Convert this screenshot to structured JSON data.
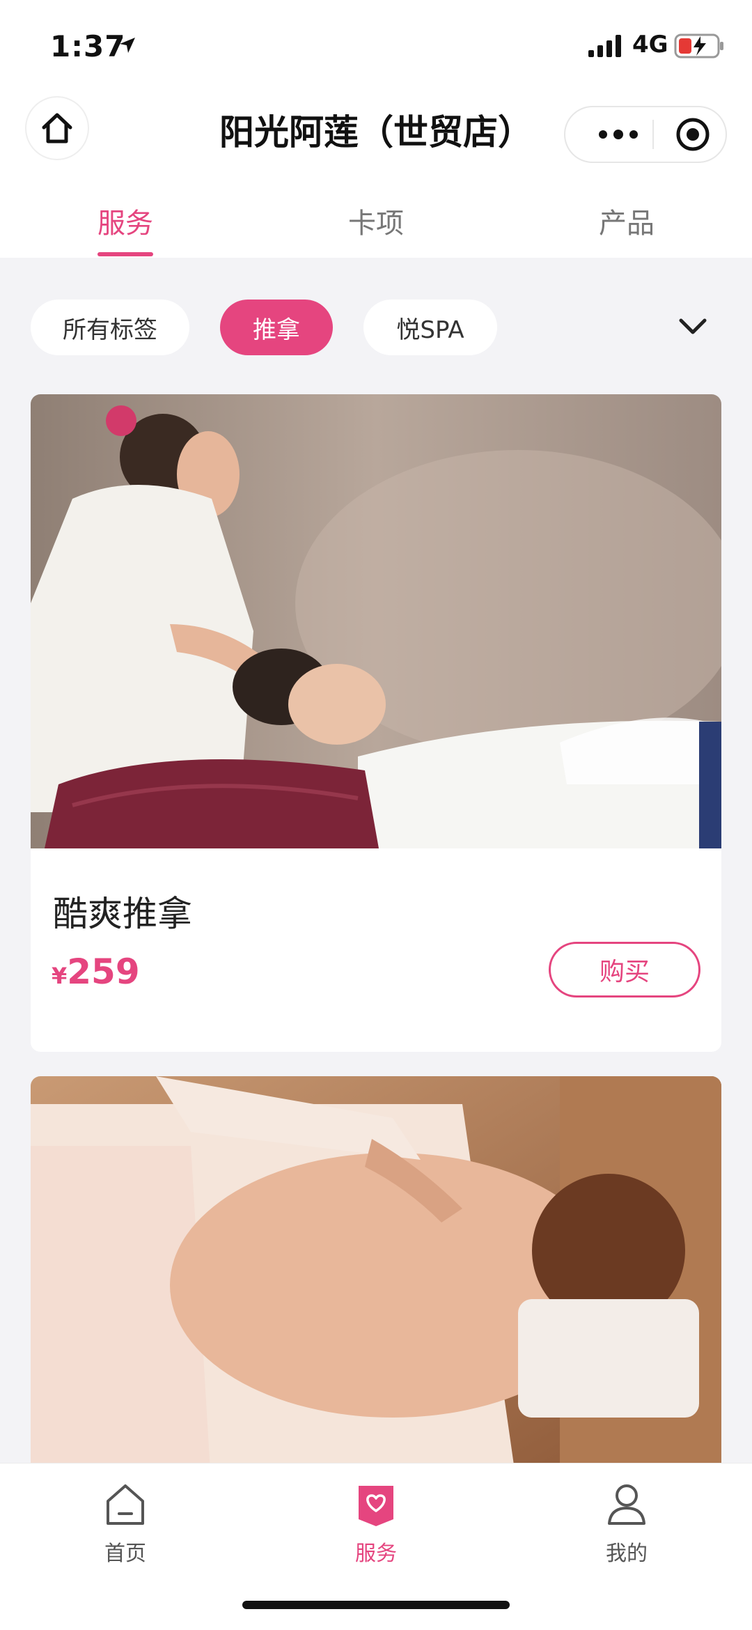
{
  "status_bar": {
    "time": "1:37",
    "network": "4G"
  },
  "nav": {
    "title": "阳光阿莲（世贸店）"
  },
  "tabs": [
    {
      "label": "服务",
      "active": true
    },
    {
      "label": "卡项",
      "active": false
    },
    {
      "label": "产品",
      "active": false
    }
  ],
  "chips": [
    {
      "label": "所有标签",
      "active": false
    },
    {
      "label": "推拿",
      "active": true
    },
    {
      "label": "悦SPA",
      "active": false
    }
  ],
  "products": [
    {
      "name": "酷爽推拿",
      "currency": "¥",
      "price": "259",
      "buy_label": "购买"
    }
  ],
  "tabbar": [
    {
      "label": "首页",
      "icon": "home-icon",
      "active": false
    },
    {
      "label": "服务",
      "icon": "heart-bag-icon",
      "active": true
    },
    {
      "label": "我的",
      "icon": "user-icon",
      "active": false
    }
  ],
  "colors": {
    "accent": "#e5457f",
    "background": "#f3f3f6"
  }
}
